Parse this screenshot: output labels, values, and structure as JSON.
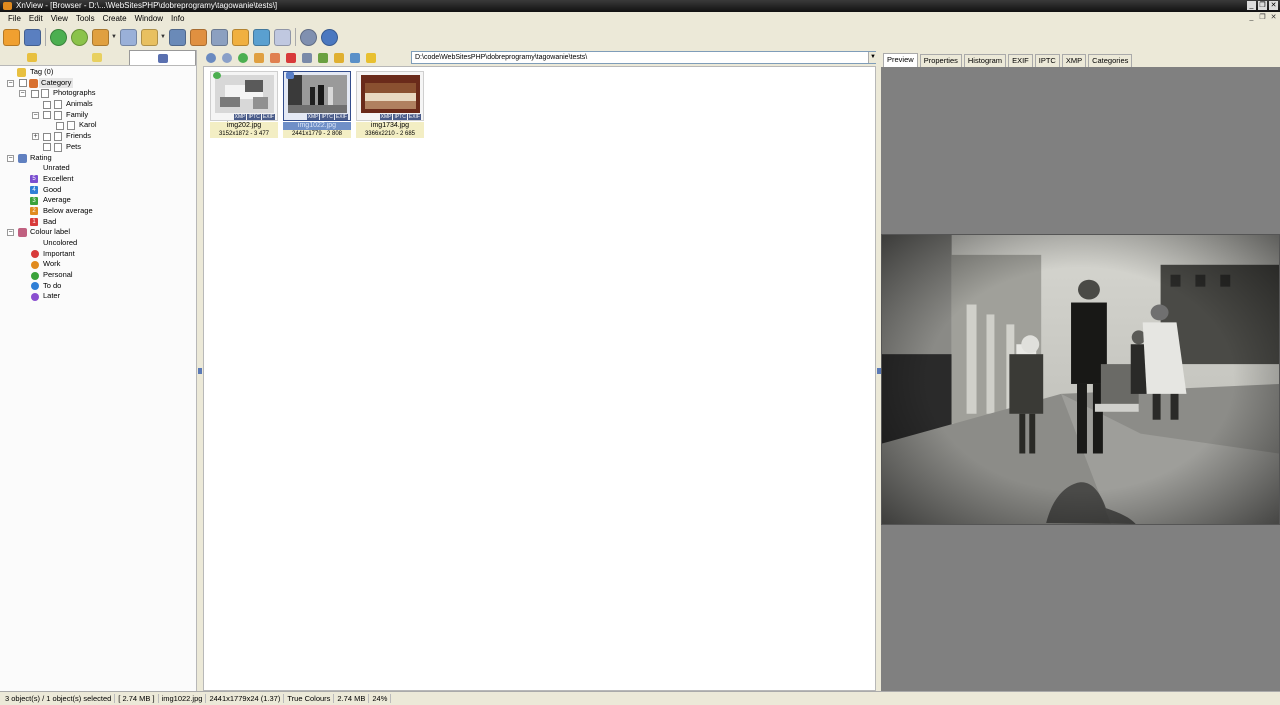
{
  "window": {
    "title": "XnView - [Browser - D:\\...\\WebSitesPHP\\dobreprogramy\\tagowanie\\tests\\]"
  },
  "menu": [
    "File",
    "Edit",
    "View",
    "Tools",
    "Create",
    "Window",
    "Info"
  ],
  "address": {
    "path": "D:\\code\\WebSitesPHP\\dobreprogramy\\tagowanie\\tests\\"
  },
  "tree": {
    "tag_root": "Tag (0)",
    "category": "Category",
    "photographs": "Photographs",
    "animals": "Animals",
    "family": "Family",
    "karol": "Karol",
    "friends": "Friends",
    "pets": "Pets",
    "rating": "Rating",
    "unrated": "Unrated",
    "excellent": "Excellent",
    "good": "Good",
    "average": "Average",
    "below_average": "Below average",
    "bad": "Bad",
    "colour_label": "Colour label",
    "uncolored": "Uncolored",
    "important": "Important",
    "work": "Work",
    "personal": "Personal",
    "todo": "To do",
    "later": "Later",
    "rating_digits": {
      "excellent": "5",
      "good": "4",
      "average": "3",
      "below_average": "2",
      "bad": "1"
    }
  },
  "colors": {
    "excellent": "#7b4fd0",
    "good": "#2f7fd6",
    "average": "#3aa23a",
    "below_average": "#e08a1e",
    "bad": "#d83a3a",
    "important": "#d83a3a",
    "work": "#e08a1e",
    "personal": "#3aa23a",
    "todo": "#2f7fd6",
    "later": "#8a4fd0"
  },
  "thumbnails": [
    {
      "name": "img202.jpg",
      "info": "3152x1872 - 3 477"
    },
    {
      "name": "img1022.jpg",
      "info": "2441x1779 - 2 808"
    },
    {
      "name": "img1734.jpg",
      "info": "3366x2210 - 2 685"
    }
  ],
  "badges": {
    "xmp": "XMP",
    "iptc": "IPTC",
    "exif": "EXIF"
  },
  "right_tabs": [
    "Preview",
    "Properties",
    "Histogram",
    "EXIF",
    "IPTC",
    "XMP",
    "Categories"
  ],
  "status": {
    "selection": "3 object(s) / 1 object(s) selected",
    "size": "[ 2.74 MB ]",
    "filename": "img1022.jpg",
    "dims": "2441x1779x24 (1.37)",
    "colours": "True Colours",
    "filesize": "2.74 MB",
    "zoom": "24%"
  }
}
